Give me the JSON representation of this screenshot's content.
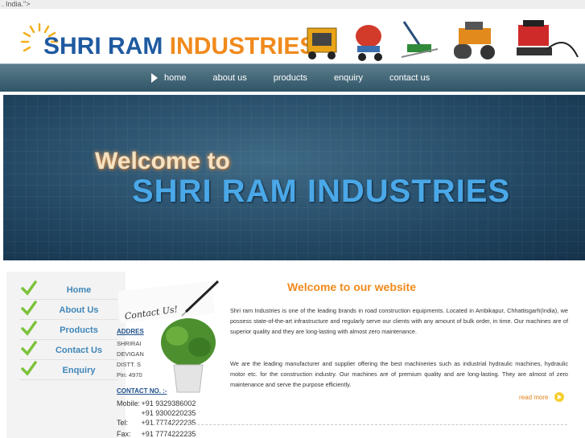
{
  "stray_text": ". India.\">",
  "header": {
    "logo_part1": "SHRI RAM",
    "logo_part2": "INDUSTRIES",
    "brand_blue": "#1f5aa0",
    "brand_orange": "#f08a1c"
  },
  "nav": {
    "items": [
      {
        "label": "home"
      },
      {
        "label": "about us"
      },
      {
        "label": "products"
      },
      {
        "label": "enquiry"
      },
      {
        "label": "contact us"
      }
    ]
  },
  "banner": {
    "welcome": "Welcome to",
    "title": "SHRI RAM INDUSTRIES"
  },
  "sidebar": {
    "items": [
      {
        "label": "Home"
      },
      {
        "label": "About Us"
      },
      {
        "label": "Products"
      },
      {
        "label": "Contact Us"
      },
      {
        "label": "Enquiry"
      }
    ]
  },
  "contact_box": {
    "note_text": "Contact Us!",
    "address_label": "ADDRES",
    "address_lines": [
      "SHRIRAI",
      "DEVIGAN",
      "DISTT. S",
      "Pin: 4970"
    ],
    "contact_label": "CONTACT NO. :-",
    "phones": [
      {
        "key": "Mobile:",
        "value": "+91 9329386002"
      },
      {
        "key": "",
        "value": "+91 9300220235"
      },
      {
        "key": "Tel:",
        "value": "+91 7774222235"
      },
      {
        "key": "Fax:",
        "value": "+91 7774222235"
      }
    ]
  },
  "main": {
    "heading": "Welcome to our website",
    "paragraph1": "Shri ram Industries is one of the leading brands in road construction equipments. Located in Ambikapur, Chhattisgarh(India), we possess state-of-the-art infrastructure and regularly serve our clients with any amount of bulk order, in time. Our machines are of superior quality and they are long-lasting with almost zero maintenance.",
    "paragraph2": "We are the leading manufacturer and supplier offering the best machineries such as industrial hydraulic machines, hydraulic motor etc. for the construction industry. Our machines are of premium quality and are long-lasting. They are almost of zero maintenance and serve the purpose efficiently.",
    "read_more": "read more"
  }
}
